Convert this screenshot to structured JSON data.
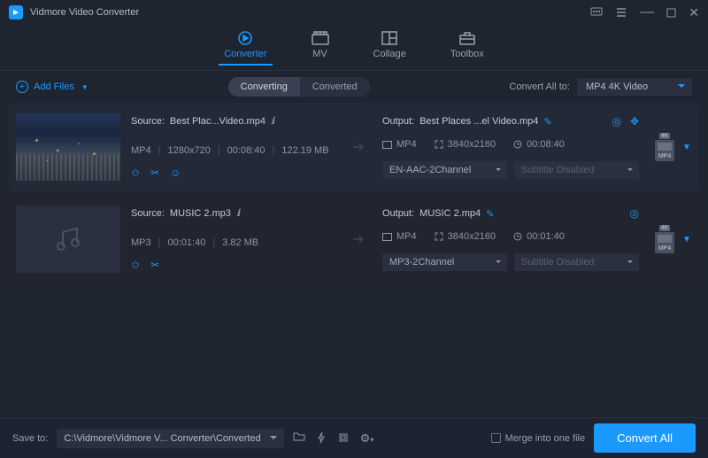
{
  "app": {
    "title": "Vidmore Video Converter"
  },
  "tabs": [
    {
      "label": "Converter"
    },
    {
      "label": "MV"
    },
    {
      "label": "Collage"
    },
    {
      "label": "Toolbox"
    }
  ],
  "toolbar": {
    "add_files": "Add Files",
    "toggle": {
      "converting": "Converting",
      "converted": "Converted"
    },
    "convert_all_label": "Convert All to:",
    "convert_all_value": "MP4 4K Video"
  },
  "files": [
    {
      "source_label": "Source:",
      "source_name": "Best Plac...Video.mp4",
      "format": "MP4",
      "resolution": "1280x720",
      "duration": "00:08:40",
      "size": "122.19 MB",
      "output_label": "Output:",
      "output_name": "Best Places ...el Video.mp4",
      "out_format": "MP4",
      "out_resolution": "3840x2160",
      "out_duration": "00:08:40",
      "audio": "EN-AAC-2Channel",
      "subtitle": "Subtitle Disabled",
      "badge4k": "4K",
      "badge_label": "MP4"
    },
    {
      "source_label": "Source:",
      "source_name": "MUSIC 2.mp3",
      "format": "MP3",
      "resolution": "",
      "duration": "00:01:40",
      "size": "3.82 MB",
      "output_label": "Output:",
      "output_name": "MUSIC 2.mp4",
      "out_format": "MP4",
      "out_resolution": "3840x2160",
      "out_duration": "00:01:40",
      "audio": "MP3-2Channel",
      "subtitle": "Subtitle Disabled",
      "badge4k": "4K",
      "badge_label": "MP4"
    }
  ],
  "footer": {
    "save_to_label": "Save to:",
    "path": "C:\\Vidmore\\Vidmore V... Converter\\Converted",
    "merge_label": "Merge into one file",
    "convert_button": "Convert All"
  }
}
